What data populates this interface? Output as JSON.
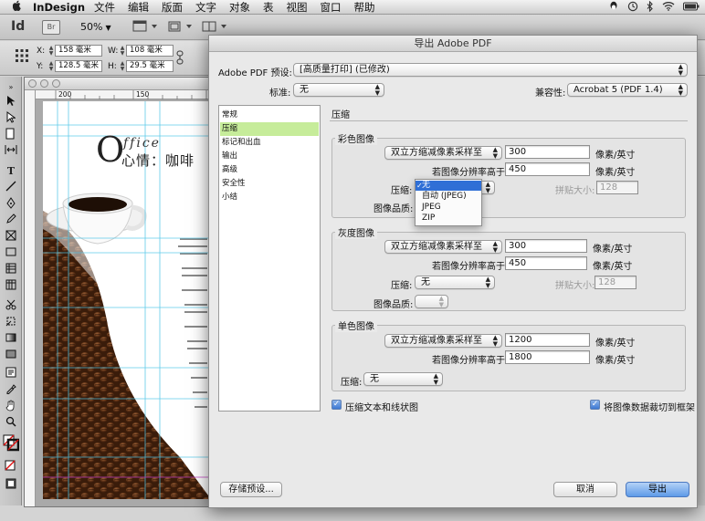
{
  "menubar": {
    "apple": "",
    "app_name": "InDesign",
    "items": [
      "文件",
      "编辑",
      "版面",
      "文字",
      "对象",
      "表",
      "视图",
      "窗口",
      "帮助"
    ]
  },
  "appbar": {
    "logo": "Id",
    "bridge": "Br",
    "zoom": "50%"
  },
  "controlbar": {
    "x_label": "X:",
    "x_value": "158 毫米",
    "y_label": "Y:",
    "y_value": "128.5 毫米",
    "w_label": "W:",
    "w_value": "108 毫米",
    "h_label": "H:",
    "h_value": "29.5 毫米"
  },
  "ruler": {
    "marks": [
      "200",
      "150",
      "100"
    ]
  },
  "document": {
    "headline_big": "O",
    "headline_script": "ffice",
    "headline_cn": "心情：咖啡"
  },
  "dialog": {
    "title": "导出 Adobe PDF",
    "preset_label": "Adobe PDF 预设:",
    "preset_value": "[高质量打印] (已修改)",
    "standard_label": "标准:",
    "standard_value": "无",
    "compat_label": "兼容性:",
    "compat_value": "Acrobat 5 (PDF 1.4)",
    "categories": [
      "常规",
      "压缩",
      "标记和出血",
      "输出",
      "高级",
      "安全性",
      "小结"
    ],
    "selected_category": "压缩",
    "section_title": "压缩",
    "color": {
      "title": "彩色图像",
      "downsample": "双立方缩减像素采样至",
      "ppi": "300",
      "unit": "像素/英寸",
      "above_label": "若图像分辨率高于:",
      "above_value": "450",
      "unit2": "像素/英寸",
      "compression_label": "压缩:",
      "quality_label": "图像品质:",
      "tile_label": "拼贴大小:",
      "tile_value": "128",
      "compression_menu": [
        "无",
        "自动 (JPEG)",
        "JPEG",
        "ZIP"
      ]
    },
    "gray": {
      "title": "灰度图像",
      "downsample": "双立方缩减像素采样至",
      "ppi": "300",
      "unit": "像素/英寸",
      "above_label": "若图像分辨率高于:",
      "above_value": "450",
      "unit2": "像素/英寸",
      "compression_label": "压缩:",
      "compression_value": "无",
      "quality_label": "图像品质:",
      "tile_label": "拼贴大小:",
      "tile_value": "128"
    },
    "mono": {
      "title": "单色图像",
      "downsample": "双立方缩减像素采样至",
      "ppi": "1200",
      "unit": "像素/英寸",
      "above_label": "若图像分辨率高于:",
      "above_value": "1800",
      "unit2": "像素/英寸",
      "compression_label": "压缩:",
      "compression_value": "无"
    },
    "compress_text_label": "压缩文本和线状图",
    "crop_label": "将图像数据裁切到框架",
    "save_preset": "存储预设...",
    "cancel": "取消",
    "export": "导出"
  }
}
